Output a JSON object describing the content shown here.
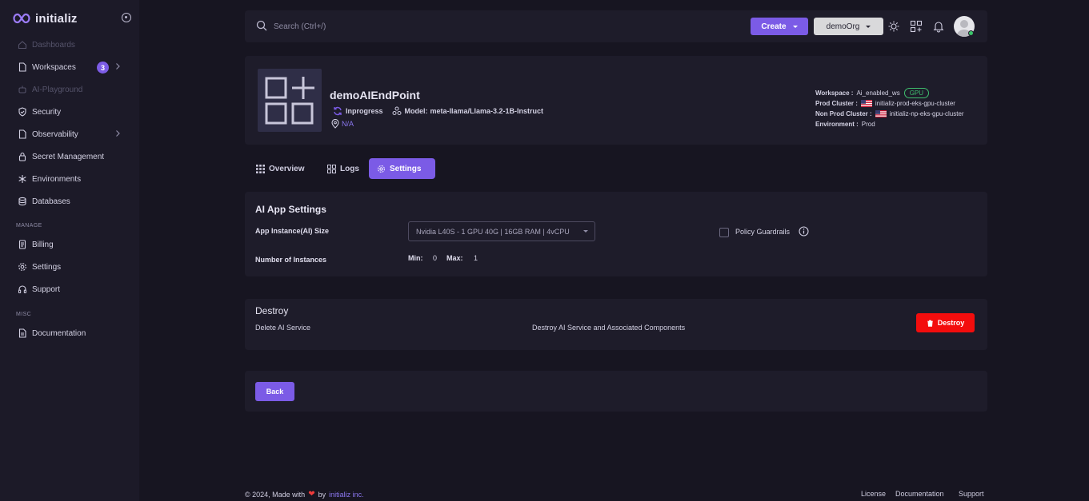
{
  "brand": {
    "name": "initializ"
  },
  "sidebar": {
    "items": [
      {
        "label": "Dashboards",
        "icon": "home-icon",
        "disabled": true
      },
      {
        "label": "Workspaces",
        "icon": "file-icon",
        "badge": "3"
      },
      {
        "label": "AI-Playground",
        "icon": "robot-icon",
        "disabled": true
      },
      {
        "label": "Security",
        "icon": "shield-icon"
      },
      {
        "label": "Observability",
        "icon": "file-icon"
      },
      {
        "label": "Secret Management",
        "icon": "lock-icon"
      },
      {
        "label": "Environments",
        "icon": "snowflake-icon"
      },
      {
        "label": "Databases",
        "icon": "database-icon"
      }
    ],
    "manage_label": "MANAGE",
    "manage_items": [
      {
        "label": "Billing",
        "icon": "receipt-icon"
      },
      {
        "label": "Settings",
        "icon": "gear-icon"
      },
      {
        "label": "Support",
        "icon": "headphones-icon"
      }
    ],
    "misc_label": "MISC",
    "misc_items": [
      {
        "label": "Documentation",
        "icon": "document-icon"
      }
    ]
  },
  "topbar": {
    "search_placeholder": "Search (Ctrl+/)",
    "create_label": "Create",
    "org_label": "demoOrg"
  },
  "app": {
    "name": "demoAIEndPoint",
    "status": "Inprogress",
    "model_label": "Model:",
    "model": "meta-llama/Llama-3.2-1B-Instruct",
    "location": "N/A",
    "workspace_label": "Workspace :",
    "workspace": "Ai_enabled_ws",
    "workspace_badge": "GPU",
    "prod_cluster_label": "Prod Cluster :",
    "prod_cluster": "initializ-prod-eks-gpu-cluster",
    "nonprod_cluster_label": "Non Prod Cluster :",
    "nonprod_cluster": "initializ-np-eks-gpu-cluster",
    "environment_label": "Environment :",
    "environment": "Prod"
  },
  "tabs": [
    {
      "label": "Overview",
      "icon": "grid-icon"
    },
    {
      "label": "Logs",
      "icon": "apps-icon"
    },
    {
      "label": "Settings",
      "icon": "gear-icon",
      "active": true
    }
  ],
  "settings": {
    "title": "AI App Settings",
    "instance_size_label": "App Instance(AI) Size",
    "instance_size_value": "Nvidia L40S - 1 GPU 40G | 16GB RAM | 4vCPU",
    "policy_label": "Policy Guardrails",
    "instances_label": "Number of Instances",
    "min_label": "Min:",
    "min_value": "0",
    "max_label": "Max:",
    "max_value": "1"
  },
  "destroy": {
    "title": "Destroy",
    "left_text": "Delete AI Service",
    "middle_text": "Destroy AI Service and Associated Components",
    "button_label": "Destroy"
  },
  "back": {
    "label": "Back"
  },
  "footer": {
    "copyright": "© 2024, Made with",
    "by": "by",
    "company": "initializ inc.",
    "links": [
      "License",
      "Documentation",
      "Support"
    ]
  },
  "colors": {
    "accent": "#7b5be6",
    "danger": "#f30d0d",
    "success": "#3fbf6e",
    "background": "#171521",
    "surface": "#1e1c2a"
  }
}
